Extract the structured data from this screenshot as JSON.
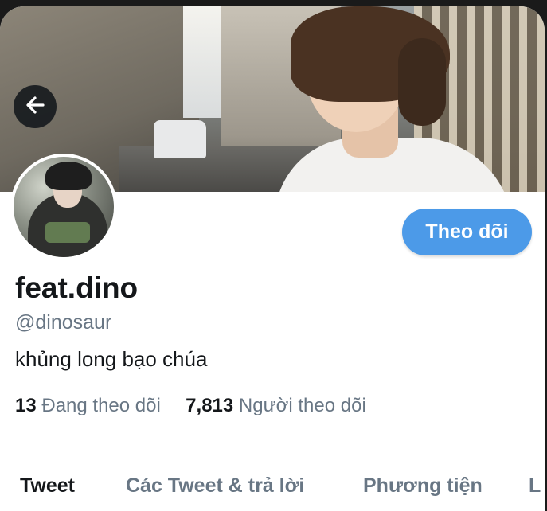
{
  "profile": {
    "display_name": "feat.dino",
    "handle": "@dinosaur",
    "bio": "khủng long bạo chúa",
    "following_count": "13",
    "following_label": "Đang theo dõi",
    "followers_count": "7,813",
    "followers_label": "Người theo dõi"
  },
  "actions": {
    "follow_label": "Theo dõi"
  },
  "tabs": [
    {
      "label": "Tweet",
      "active": true
    },
    {
      "label": "Các Tweet & trả lời",
      "active": false
    },
    {
      "label": "Phương tiện",
      "active": false
    },
    {
      "label": "L",
      "active": false
    }
  ],
  "icons": {
    "back": "arrow-left-icon"
  },
  "colors": {
    "accent": "#4c9ae8",
    "primary_text": "#14171a",
    "secondary_text": "#687684"
  }
}
